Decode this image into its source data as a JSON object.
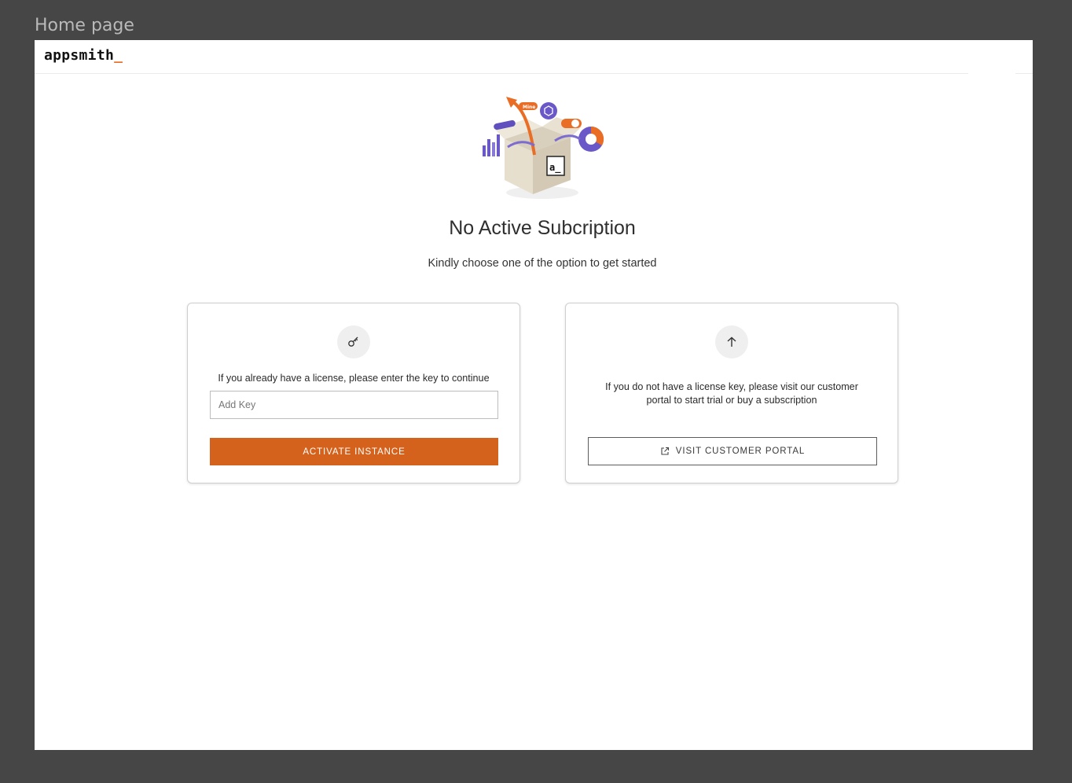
{
  "frame_label": "Home page",
  "brand": {
    "name": "appsmith",
    "cursor": "_",
    "accent": "#e96d25"
  },
  "hero": {
    "badge_text": "Mine",
    "box_mark": "a_"
  },
  "title": "No Active Subcription",
  "subtitle": "Kindly choose one of the option to get started",
  "license_card": {
    "icon": "key-icon",
    "text": "If you already have a license, please enter the key to continue",
    "input_placeholder": "Add Key",
    "input_value": "",
    "button_label": "ACTIVATE INSTANCE",
    "button_color": "#d4621c"
  },
  "portal_card": {
    "icon": "arrow-up-icon",
    "text": "If you do not have a license key, please visit our customer portal to start trial or buy a subscription",
    "button_icon": "external-link-icon",
    "button_label": "VISIT CUSTOMER PORTAL"
  }
}
